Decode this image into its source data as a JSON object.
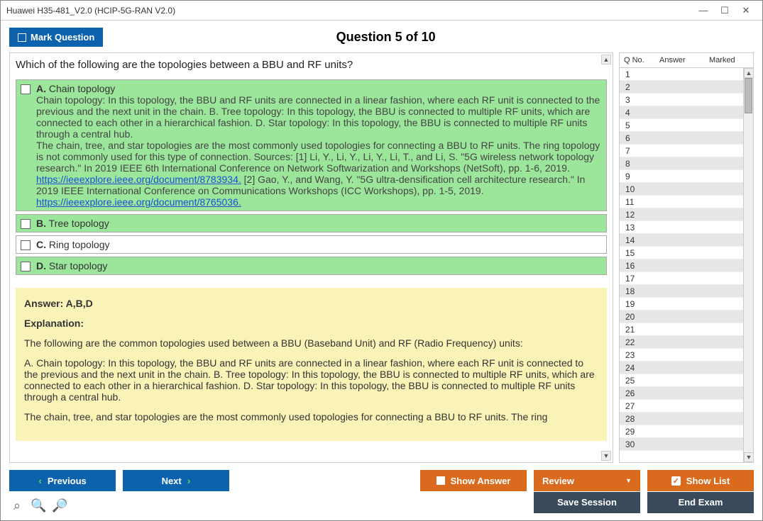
{
  "window": {
    "title": "Huawei H35-481_V2.0 (HCIP-5G-RAN V2.0)"
  },
  "header": {
    "mark_label": "Mark Question",
    "question_title": "Question 5 of 10"
  },
  "question": {
    "text": "Which of the following are the topologies between a BBU and RF units?",
    "options": [
      {
        "letter": "A.",
        "title": "Chain topology",
        "correct": true,
        "desc": "Chain topology: In this topology, the BBU and RF units are connected in a linear fashion, where each RF unit is connected to the previous and the next unit in the chain. B. Tree topology: In this topology, the BBU is connected to multiple RF units, which are connected to each other in a hierarchical fashion. D. Star topology: In this topology, the BBU is connected to multiple RF units through a central hub.",
        "desc2": "The chain, tree, and star topologies are the most commonly used topologies for connecting a BBU to RF units. The ring topology is not commonly used for this type of connection. Sources: [1] Li, Y., Li, Y., Li, Y., Li, T., and Li, S. \"5G wireless network topology research.\" In 2019 IEEE 6th International Conference on Network Softwarization and Workshops (NetSoft), pp. 1-6, 2019. ",
        "link1": "https://ieeexplore.ieee.org/document/8783934.",
        "desc3": " [2] Gao, Y., and Wang, Y. \"5G ultra-densification cell architecture research.\" In 2019 IEEE International Conference on Communications Workshops (ICC Workshops), pp. 1-5, 2019. ",
        "link2": "https://ieeexplore.ieee.org/document/8765036."
      },
      {
        "letter": "B.",
        "title": "Tree topology",
        "correct": true
      },
      {
        "letter": "C.",
        "title": "Ring topology",
        "correct": false
      },
      {
        "letter": "D.",
        "title": "Star topology",
        "correct": true
      }
    ],
    "answer_line": "Answer: A,B,D",
    "explanation_header": "Explanation:",
    "explanation_p1": "The following are the common topologies used between a BBU (Baseband Unit) and RF (Radio Frequency) units:",
    "explanation_p2": "A. Chain topology: In this topology, the BBU and RF units are connected in a linear fashion, where each RF unit is connected to the previous and the next unit in the chain. B. Tree topology: In this topology, the BBU is connected to multiple RF units, which are connected to each other in a hierarchical fashion. D. Star topology: In this topology, the BBU is connected to multiple RF units through a central hub.",
    "explanation_p3": "The chain, tree, and star topologies are the most commonly used topologies for connecting a BBU to RF units. The ring"
  },
  "sidebar": {
    "headers": {
      "qno": "Q No.",
      "answer": "Answer",
      "marked": "Marked"
    },
    "rows": [
      1,
      2,
      3,
      4,
      5,
      6,
      7,
      8,
      9,
      10,
      11,
      12,
      13,
      14,
      15,
      16,
      17,
      18,
      19,
      20,
      21,
      22,
      23,
      24,
      25,
      26,
      27,
      28,
      29,
      30
    ]
  },
  "buttons": {
    "previous": "Previous",
    "next": "Next",
    "show_answer": "Show Answer",
    "review": "Review",
    "show_list": "Show List",
    "save_session": "Save Session",
    "end_exam": "End Exam"
  }
}
